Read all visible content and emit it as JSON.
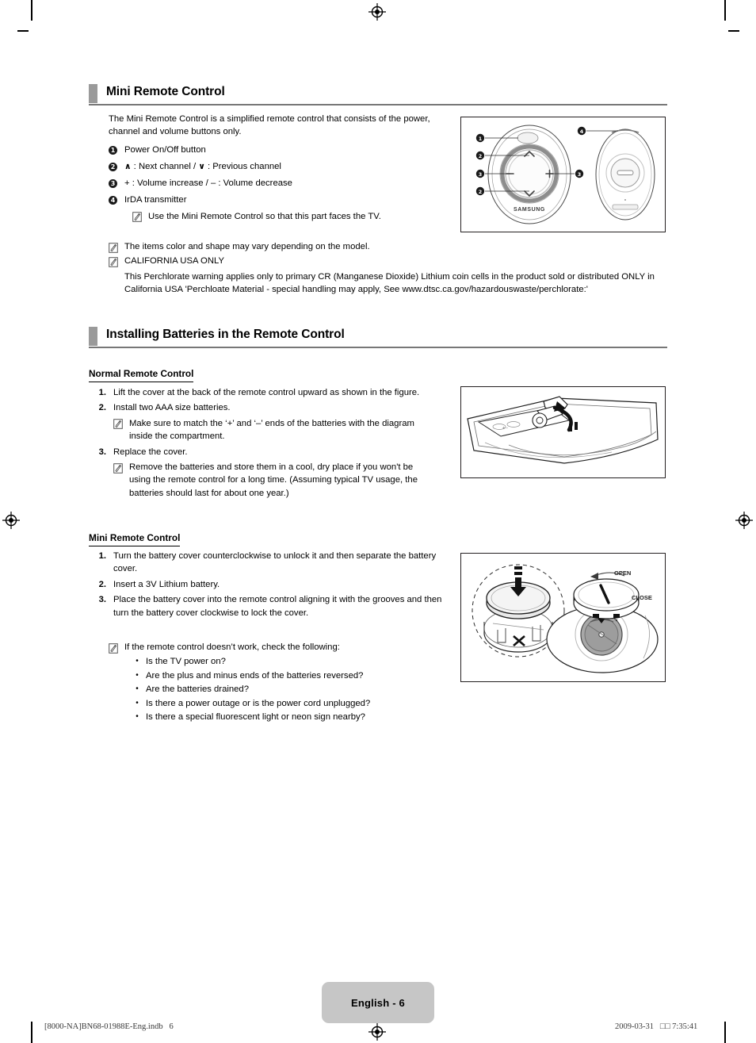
{
  "document": {
    "page_label": "English - 6",
    "footer_left": "[8000-NA]BN68-01988E-Eng.indb   6",
    "footer_right": "2009-03-31   □□ 7:35:41"
  },
  "section1": {
    "title": "Mini Remote Control",
    "intro": "The Mini Remote Control is a simplified remote control that consists of the power, channel and volume buttons only.",
    "items": [
      {
        "num": "1",
        "text": "Power On/Off button"
      },
      {
        "num": "2",
        "text_pre": "",
        "chev_up": "∧",
        "text_mid": " : Next channel / ",
        "chev_down": "∨",
        "text_post": " : Previous channel"
      },
      {
        "num": "3",
        "text": "+ : Volume increase / – : Volume decrease"
      },
      {
        "num": "4",
        "text": "IrDA transmitter"
      }
    ],
    "item4_note": "Use the Mini Remote Control so that this part faces the TV.",
    "notes": [
      "The items color and shape may vary depending on the model.",
      "CALIFORNIA USA ONLY"
    ],
    "perchlorate": "This Perchlorate warning applies only to primary CR (Manganese Dioxide) Lithium coin cells in the product sold or distributed ONLY in California USA 'Perchloate Material - special handling may apply, See www.dtsc.ca.gov/hazardouswaste/perchlorate:'"
  },
  "section2": {
    "title": "Installing Batteries in the Remote Control",
    "normal": {
      "subhead": "Normal Remote Control",
      "steps": [
        {
          "num": "1.",
          "text": "Lift the cover at the back of the remote control upward as shown in the figure."
        },
        {
          "num": "2.",
          "text": "Install two AAA size batteries.",
          "note": "Make sure to match the ‘+’ and ‘–’ ends of the batteries with the diagram inside the compartment."
        },
        {
          "num": "3.",
          "text": "Replace the cover.",
          "note": "Remove the batteries and store them in a cool, dry place if you won't be using the remote control for a long time. (Assuming typical TV usage, the batteries should last for about one year.)"
        }
      ]
    },
    "mini": {
      "subhead": "Mini Remote Control",
      "steps": [
        {
          "num": "1.",
          "text": "Turn the battery cover counterclockwise to unlock it and then separate the battery cover."
        },
        {
          "num": "2.",
          "text": "Insert a 3V Lithium battery."
        },
        {
          "num": "3.",
          "text": "Place the battery cover into the remote control aligning it with the grooves and then turn the battery cover clockwise to lock the cover."
        }
      ],
      "troubleshoot_intro": "If the remote control doesn’t work, check the following:",
      "troubleshoot_items": [
        "Is the TV power on?",
        "Are the plus and minus ends of the batteries reversed?",
        "Are the batteries drained?",
        "Is there a power outage or is the power cord unplugged?",
        "Is there a special fluorescent light or neon sign nearby?"
      ]
    }
  },
  "figures": {
    "mini_remote": {
      "brand": "SAMSUNG",
      "callouts": [
        "1",
        "2",
        "3",
        "2",
        "3",
        "4"
      ],
      "button_up": "∧",
      "button_down": "∨",
      "button_plus": "+",
      "button_minus": "–"
    },
    "mini_battery": {
      "label_open": "OPEN",
      "label_close": "CLOSE"
    }
  },
  "colors": {
    "head_bar": "#9a9a9a",
    "head_rule": "#777777",
    "badge_bg": "#c6c6c6",
    "figure_border": "#231f20"
  }
}
